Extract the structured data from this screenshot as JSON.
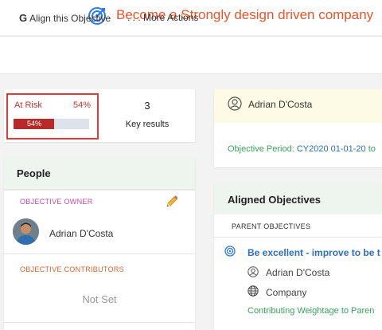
{
  "header": {
    "title": "Become a Strongly design driven company",
    "icon": "target-icon",
    "accent_color": "#e8542b"
  },
  "actions": {
    "align_label": "Align this Objective",
    "more_label": ". . . More Actions"
  },
  "status": {
    "risk_label": "At Risk",
    "risk_percent": "54%",
    "progress_text": "54%",
    "progress_value": 0.54,
    "progress_color": "#b82a2a",
    "key_results_count": "3",
    "key_results_label": "Key results"
  },
  "people": {
    "title": "People",
    "owner_label": "OBJECTIVE OWNER",
    "owner_name": "Adrian D'Costa",
    "contributors_label": "OBJECTIVE CONTRIBUTORS",
    "contributors_value": "Not Set"
  },
  "info": {
    "owner_name": "Adrian D'Costa",
    "period_label": "Objective Period:",
    "period_value": "CY2020 01-01-20",
    "period_more": "to"
  },
  "aligned": {
    "title": "Aligned Objectives",
    "parent_label": "PARENT OBJECTIVES",
    "parent_title": "Be excellent - improve to be t",
    "parent_owner": "Adrian D'Costa",
    "parent_scope": "Company",
    "weightage_label": "Contributing Weightage to Paren"
  }
}
